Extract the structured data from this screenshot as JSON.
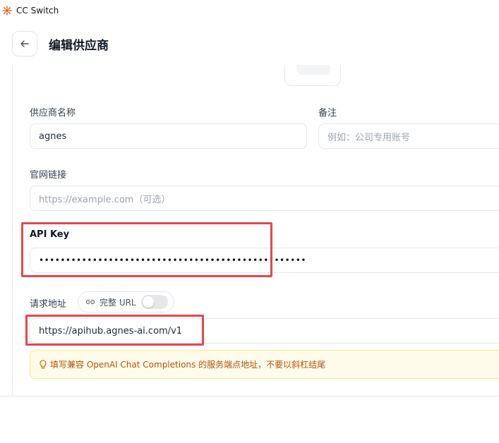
{
  "window": {
    "title": "CC Switch",
    "app_icon": "sun-logo-icon"
  },
  "header": {
    "back_icon": "arrow-left-icon",
    "title": "编辑供应商"
  },
  "form": {
    "provider_name": {
      "label": "供应商名称",
      "value": "agnes"
    },
    "note": {
      "label": "备注",
      "placeholder": "例如：公司专用账号"
    },
    "website": {
      "label": "官网链接",
      "placeholder": "https://example.com（可选）"
    },
    "api_key": {
      "label": "API Key",
      "masked_value": "••••••••••••••••••••••••••••••••••••••••••••••••••"
    },
    "endpoint": {
      "label": "请求地址",
      "full_url_toggle_label": "完整 URL",
      "full_url_enabled": false,
      "value": "https://apihub.agnes-ai.com/v1",
      "hint": "填写兼容 OpenAI Chat Completions 的服务端点地址，不要以斜杠结尾"
    }
  },
  "colors": {
    "highlight": "#e5484d",
    "hint_text": "#b45309",
    "hint_bg": "#fffbeb"
  }
}
